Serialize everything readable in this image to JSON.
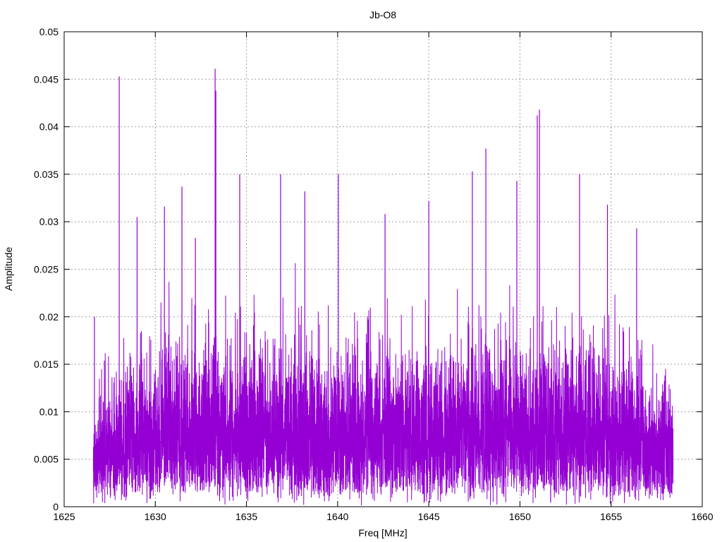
{
  "chart_data": {
    "type": "line",
    "title": "Jb-O8",
    "xlabel": "Freq [MHz]",
    "ylabel": "Amplitude",
    "xlim": [
      1625,
      1660
    ],
    "ylim": [
      0,
      0.05
    ],
    "grid": true,
    "legend": "none",
    "series_color": "#9400d3",
    "grid_color": "#a0a0a0",
    "x_ticks": [
      "1625",
      "1630",
      "1635",
      "1640",
      "1645",
      "1650",
      "1655",
      "1660"
    ],
    "y_ticks": [
      "0",
      "0.005",
      "0.01",
      "0.015",
      "0.02",
      "0.025",
      "0.03",
      "0.035",
      "0.04",
      "0.045",
      "0.05"
    ],
    "series": [
      {
        "name": "Amplitude",
        "x_range": [
          1626.6,
          1658.4
        ],
        "num_samples": 6000,
        "noise_model": "rayleigh",
        "noise_scale_center": 0.0062,
        "noise_scale_edge": 0.0048,
        "seed": 12345,
        "peaks": [
          {
            "x": 1628.02,
            "y": 0.0453
          },
          {
            "x": 1633.28,
            "y": 0.0461
          },
          {
            "x": 1633.32,
            "y": 0.0438
          },
          {
            "x": 1650.95,
            "y": 0.0412
          },
          {
            "x": 1651.07,
            "y": 0.0418
          },
          {
            "x": 1648.13,
            "y": 0.0377
          },
          {
            "x": 1647.39,
            "y": 0.0353
          },
          {
            "x": 1640.04,
            "y": 0.035
          },
          {
            "x": 1636.87,
            "y": 0.035
          },
          {
            "x": 1634.63,
            "y": 0.035
          },
          {
            "x": 1653.27,
            "y": 0.035
          },
          {
            "x": 1649.83,
            "y": 0.0343
          },
          {
            "x": 1631.46,
            "y": 0.0337
          },
          {
            "x": 1626.66,
            "y": 0.02
          },
          {
            "x": 1629.0,
            "y": 0.0305
          },
          {
            "x": 1630.5,
            "y": 0.0316
          },
          {
            "x": 1632.2,
            "y": 0.0283
          },
          {
            "x": 1638.2,
            "y": 0.0332
          },
          {
            "x": 1642.6,
            "y": 0.0308
          },
          {
            "x": 1645.0,
            "y": 0.0322
          },
          {
            "x": 1654.8,
            "y": 0.0318
          },
          {
            "x": 1656.4,
            "y": 0.0293
          }
        ]
      }
    ]
  }
}
